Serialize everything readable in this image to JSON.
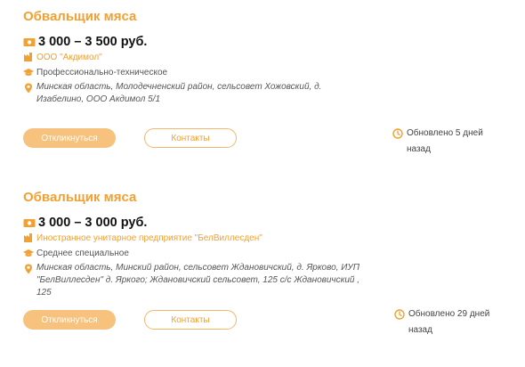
{
  "vacancies": [
    {
      "title": "Обвальщик мяса",
      "salary": "3 000 – 3 500 руб.",
      "company": "ООО \"Акдимол\"",
      "education": "Профессионально-техническое",
      "address": "Минская область, Молодечненский район, сельсовет Хожовский, д. Изабелино, ООО Акдимол 5/1",
      "apply_label": "Откликнуться",
      "contacts_label": "Контакты",
      "updated_line1": "Обновлено 5 дней",
      "updated_line2": "назад"
    },
    {
      "title": "Обвальщик мяса",
      "salary": "3 000 – 3 000 руб.",
      "company": "Иностранное унитарное предприятие \"БелВиллесден\"",
      "education": "Среднее специальное",
      "address": "Минская область, Минский район, сельсовет Ждановичский, д. Ярково, ИУП \"БелВиллесден\" д. Яркого; Ждановичский сельсовет, 125 с/с Ждановичский , 125",
      "apply_label": "Откликнуться",
      "contacts_label": "Контакты",
      "updated_line1": "Обновлено 29 дней",
      "updated_line2": "назад"
    }
  ],
  "icons": {
    "salary": "money-icon",
    "company": "factory-icon",
    "education": "graduation-cap-icon",
    "address": "location-pin-icon",
    "updated": "clock-icon"
  },
  "colors": {
    "accent": "#f2a032",
    "button_fill": "#f7c27d",
    "button_outline": "#f2b76a"
  }
}
